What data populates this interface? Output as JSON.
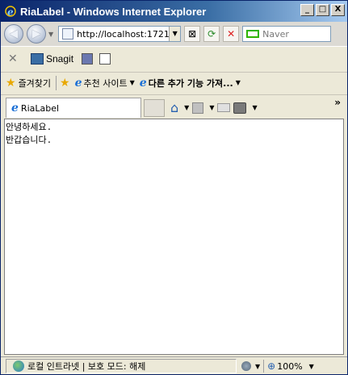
{
  "window": {
    "title": "RiaLabel - Windows Internet Explorer",
    "buttons": {
      "minimize": "_",
      "maximize": "□",
      "close": "X"
    }
  },
  "addressbar": {
    "url": "http://localhost:1721",
    "search_placeholder": "Naver"
  },
  "snagit": {
    "label": "Snagit"
  },
  "favorites": {
    "label": "즐겨찾기",
    "items": [
      "추천 사이트",
      "다른 추가 기능 가져..."
    ]
  },
  "tab": {
    "label": "RiaLabel"
  },
  "content": {
    "lines": [
      "안녕하세요.",
      "반갑습니다."
    ]
  },
  "status": {
    "zone": "로컬 인트라넷 | 보호 모드: 해제",
    "zoom": "100%"
  },
  "colors": {
    "title_bar": "#0a246a",
    "naver_green": "#2db400"
  }
}
